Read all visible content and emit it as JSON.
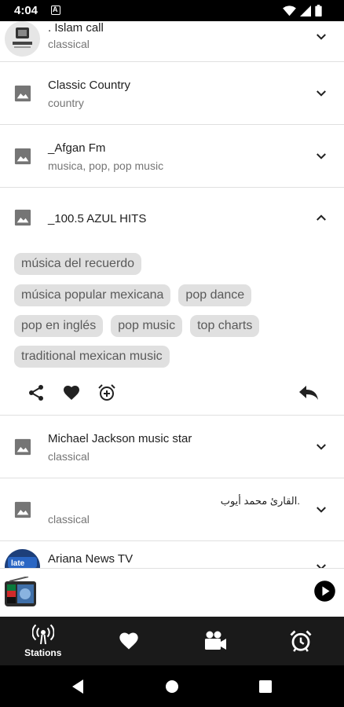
{
  "status_bar": {
    "time": "4:04"
  },
  "stations": [
    {
      "title": ". Islam call",
      "subtitle": "classical",
      "expanded": false
    },
    {
      "title": "Classic Country",
      "subtitle": "country",
      "expanded": false
    },
    {
      "title": "_Afgan Fm",
      "subtitle": "musica, pop, pop music",
      "expanded": false
    },
    {
      "title": "_100.5 AZUL HITS",
      "subtitle": "",
      "expanded": true
    },
    {
      "title": "Michael Jackson music star",
      "subtitle": "classical",
      "expanded": false
    },
    {
      "title": ".القارئ محمد أيوب",
      "subtitle": "classical",
      "expanded": false
    },
    {
      "title": "Ariana News TV",
      "subtitle": "",
      "expanded": false
    }
  ],
  "expanded_tags": [
    "música del recuerdo",
    "música popular mexicana",
    "pop dance",
    "pop en inglés",
    "pop music",
    "top charts",
    "traditional mexican music"
  ],
  "bottom_nav": {
    "items": [
      {
        "label": "Stations",
        "icon": "radio-tower-icon",
        "active": true
      },
      {
        "label": "",
        "icon": "heart-icon",
        "active": false
      },
      {
        "label": "",
        "icon": "video-camera-icon",
        "active": false
      },
      {
        "label": "",
        "icon": "alarm-clock-icon",
        "active": false
      }
    ]
  },
  "colors": {
    "nav_background": "#1a1a1a",
    "tag_background": "#e0e0e0",
    "divider": "#e0e0e0"
  }
}
